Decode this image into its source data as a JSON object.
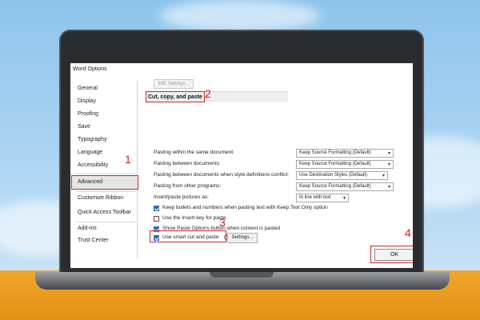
{
  "window": {
    "title": "Word Options"
  },
  "sidebar": {
    "items": [
      {
        "label": "General"
      },
      {
        "label": "Display"
      },
      {
        "label": "Proofing"
      },
      {
        "label": "Save"
      },
      {
        "label": "Typography"
      },
      {
        "label": "Language"
      },
      {
        "label": "Accessibility"
      },
      {
        "label": "Advanced",
        "selected": true
      },
      {
        "label": "Customize Ribbon"
      },
      {
        "label": "Quick Access Toolbar"
      },
      {
        "label": "Add-ins"
      },
      {
        "label": "Trust Center"
      }
    ]
  },
  "main": {
    "ime_button": "IME Settings...",
    "section_title": "Cut, copy, and paste",
    "settings": [
      {
        "label": "Pasting within the same document:",
        "value": "Keep Source Formatting (Default)"
      },
      {
        "label": "Pasting between documents:",
        "value": "Keep Source Formatting (Default)"
      },
      {
        "label": "Pasting between documents when style definitions conflict:",
        "value": "Use Destination Styles (Default)"
      },
      {
        "label": "Pasting from other programs:",
        "value": "Keep Source Formatting (Default)"
      },
      {
        "label": "Insert/paste pictures as:",
        "value": "In line with text"
      }
    ],
    "checkboxes": [
      {
        "label": "Keep bullets and numbers when pasting text with Keep Text Only option",
        "checked": true
      },
      {
        "label": "Use the Insert key for paste",
        "checked": false
      },
      {
        "label": "Show Paste Options button when content is pasted",
        "checked": true
      },
      {
        "label": "Use smart cut and paste",
        "checked": true
      }
    ],
    "settings_button": "Settings...",
    "ok_button": "OK"
  },
  "annotations": {
    "step1": "1",
    "step2": "2",
    "step3": "3",
    "step4": "4"
  },
  "colors": {
    "highlight": "#cc2828",
    "sky": "#a9d3f2",
    "desk": "#f0a62b",
    "checkbox": "#2b6bbf"
  },
  "icons": {
    "info": "info-icon",
    "dropdown": "chevron-down-icon"
  }
}
